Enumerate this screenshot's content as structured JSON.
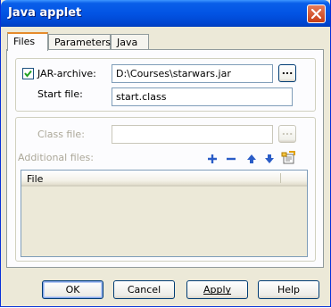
{
  "window": {
    "title": "Java applet"
  },
  "tabs": [
    {
      "label": "Files"
    },
    {
      "label": "Parameters"
    },
    {
      "label": "Java"
    }
  ],
  "jar": {
    "checkbox_label": "JAR-archive:",
    "checked": true,
    "path": "D:\\Courses\\starwars.jar",
    "browse_label": "...",
    "start_file_label": "Start file:",
    "start_file": "start.class"
  },
  "classfile": {
    "label": "Class file:",
    "value": "",
    "browse_label": "...",
    "additional_label": "Additional files:",
    "list_header": "File"
  },
  "buttons": {
    "ok": "OK",
    "cancel": "Cancel",
    "apply": "Apply",
    "help": "Help"
  }
}
